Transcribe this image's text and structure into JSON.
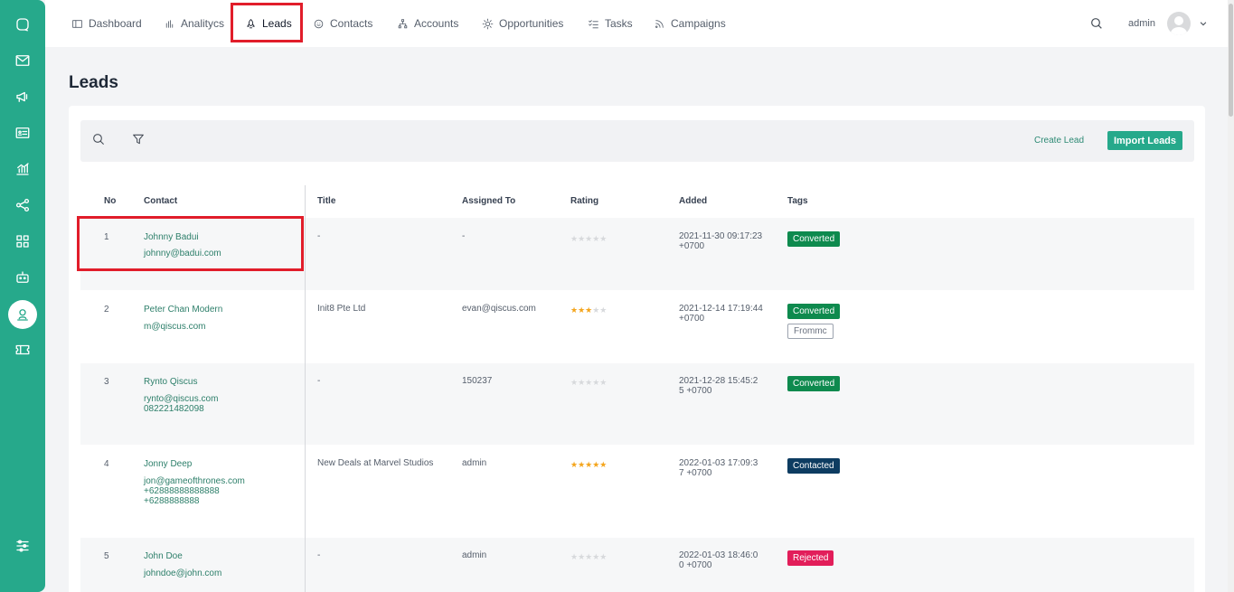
{
  "nav": {
    "items": [
      {
        "label": "Dashboard",
        "icon": "layout-icon"
      },
      {
        "label": "Analitycs",
        "icon": "bar-chart-icon"
      },
      {
        "label": "Leads",
        "icon": "rocket-icon"
      },
      {
        "label": "Contacts",
        "icon": "smiley-icon"
      },
      {
        "label": "Accounts",
        "icon": "org-chart-icon"
      },
      {
        "label": "Opportunities",
        "icon": "sun-icon"
      },
      {
        "label": "Tasks",
        "icon": "checklist-icon"
      },
      {
        "label": "Campaigns",
        "icon": "rss-icon"
      }
    ],
    "active": "Leads",
    "user": "admin"
  },
  "sidebar": {
    "icons": [
      "chat-icon",
      "mail-icon",
      "megaphone-icon",
      "contact-card-icon",
      "analytics-icon",
      "share-nodes-icon",
      "grid-icon",
      "robot-icon",
      "user-circle-icon",
      "ticket-icon",
      "settings-sliders-icon"
    ],
    "active": "user-circle-icon"
  },
  "page": {
    "title": "Leads",
    "create_label": "Create Lead",
    "import_label": "Import Leads"
  },
  "table": {
    "headers": {
      "no": "No",
      "contact": "Contact",
      "title": "Title",
      "assigned": "Assigned To",
      "rating": "Rating",
      "added": "Added",
      "tags": "Tags"
    },
    "rows": [
      {
        "no": "1",
        "name": "Johnny Badui",
        "email": "johnny@badui.com",
        "extra": "",
        "title": "-",
        "assigned": "-",
        "rating": 0,
        "added1": "2021-11-30 09:17:23",
        "added2": "+0700",
        "tag1": "Converted",
        "tag2": ""
      },
      {
        "no": "2",
        "name": "Peter Chan Modern",
        "email": "m@qiscus.com",
        "extra": "",
        "title": "Init8 Pte Ltd",
        "assigned": "evan@qiscus.com",
        "rating": 3,
        "added1": "2021-12-14 17:19:44",
        "added2": "+0700",
        "tag1": "Converted",
        "tag2": "Frommc"
      },
      {
        "no": "3",
        "name": "Rynto Qiscus",
        "email": "rynto@qiscus.com",
        "extra": "082221482098",
        "title": "-",
        "assigned": "150237",
        "rating": 0,
        "added1": "2021-12-28 15:45:2",
        "added2": "5 +0700",
        "tag1": "Converted",
        "tag2": ""
      },
      {
        "no": "4",
        "name": "Jonny Deep",
        "email": "jon@gameofthrones.com",
        "extra": "+62888888888888",
        "extra2": "+6288888888",
        "title": "New Deals at Marvel Studios",
        "assigned": "admin",
        "rating": 5,
        "added1": "2022-01-03 17:09:3",
        "added2": "7 +0700",
        "tag1": "Contacted",
        "tag2": ""
      },
      {
        "no": "5",
        "name": "John Doe",
        "email": "johndoe@john.com",
        "extra": "",
        "title": "-",
        "assigned": "admin",
        "rating": 0,
        "added1": "2022-01-03 18:46:0",
        "added2": "0 +0700",
        "tag1": "Rejected",
        "tag2": ""
      }
    ]
  },
  "colors": {
    "brand": "#26a98b",
    "highlight": "#e11d2a",
    "converted": "#0e8a4e",
    "contacted": "#0d3c61",
    "rejected": "#e21e5a",
    "star": "#f4a51c"
  }
}
